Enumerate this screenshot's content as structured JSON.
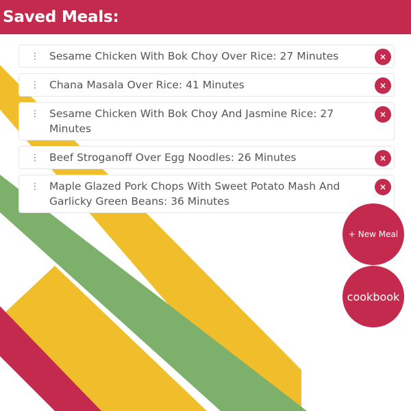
{
  "header": {
    "title": "Saved Meals:"
  },
  "meals": [
    {
      "text": "Sesame Chicken With Bok Choy Over Rice: 27 Minutes",
      "delete_label": "×"
    },
    {
      "text": "Chana Masala Over Rice: 41 Minutes",
      "delete_label": "×"
    },
    {
      "text": "Sesame Chicken With Bok Choy And Jasmine Rice: 27 Minutes",
      "delete_label": "×"
    },
    {
      "text": "Beef Stroganoff Over Egg Noodles: 26 Minutes",
      "delete_label": "×"
    },
    {
      "text": "Maple Glazed Pork Chops With Sweet Potato Mash And Garlicky Green Beans: 36 Minutes",
      "delete_label": "×"
    }
  ],
  "icons": {
    "drag_handle": "drag-handle-icon",
    "delete": "close-icon"
  },
  "actions": {
    "new_meal_label": "+ New Meal",
    "cookbook_label": "cookbook"
  },
  "colors": {
    "primary": "#c32a4e",
    "yellow": "#f0be2a",
    "green": "#7db16b",
    "background": "#ffffff"
  }
}
